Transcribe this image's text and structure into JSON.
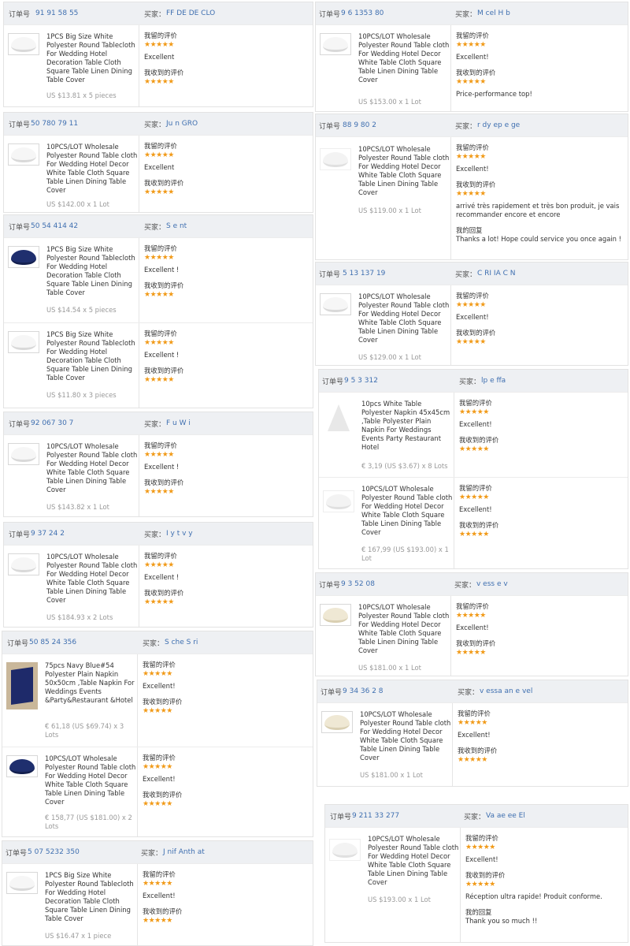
{
  "labels": {
    "order_no": "订单号",
    "buyer": "买家：",
    "my_review": "我留的评价",
    "received_review": "我收到的评价",
    "my_reply": "我的回复",
    "stars": "★★★★★"
  },
  "left_column": [
    {
      "order_no": "91 91 58 55",
      "buyer": "FF DE DE CLO",
      "items": [
        {
          "thumb": "white",
          "title": "1PCS Big Size White Polyester Round Tablecloth For Wedding Hotel Decoration Table Cloth Square Table Linen Dining Table Cover",
          "price": "US $13.81 x 5 pieces",
          "my_review": "Excellent",
          "received_review": ""
        }
      ]
    },
    {
      "order_no": "50 780 79 11",
      "buyer": "Ju n GRO",
      "items": [
        {
          "thumb": "white",
          "title": "10PCS/LOT Wholesale Polyester Round Table cloth For Wedding Hotel Decor White Table Cloth Square Table Linen Dining Table Cover",
          "price": "US $142.00 x 1 Lot",
          "my_review": "Excellent",
          "received_review": ""
        }
      ]
    },
    {
      "order_no": "50 54 414 42",
      "buyer": "S e nt",
      "items": [
        {
          "thumb": "navy",
          "title": "1PCS Big Size White Polyester Round Tablecloth For Wedding Hotel Decoration Table Cloth Square Table Linen Dining Table Cover",
          "price": "US $14.54 x 5 pieces",
          "my_review": "Excellent !",
          "received_review": ""
        },
        {
          "thumb": "white",
          "title": "1PCS Big Size White Polyester Round Tablecloth For Wedding Hotel Decoration Table Cloth Square Table Linen Dining Table Cover",
          "price": "US $11.80 x 3 pieces",
          "my_review": "Excellent !",
          "received_review": ""
        }
      ]
    },
    {
      "order_no": "92 067 30 7",
      "buyer": "F u W i",
      "items": [
        {
          "thumb": "white",
          "title": "10PCS/LOT Wholesale Polyester Round Table cloth For Wedding Hotel Decor White Table Cloth Square Table Linen Dining Table Cover",
          "price": "US $143.82 x 1 Lot",
          "my_review": "Excellent !",
          "received_review": ""
        }
      ]
    },
    {
      "order_no": "9 37 24 2",
      "buyer": "I y t v y",
      "items": [
        {
          "thumb": "white",
          "title": "10PCS/LOT Wholesale Polyester Round Table cloth For Wedding Hotel Decor White Table Cloth Square Table Linen Dining Table Cover",
          "price": "US $184.93 x 2 Lots",
          "my_review": "Excellent !",
          "received_review": ""
        }
      ]
    },
    {
      "order_no": "50 85 24 356",
      "buyer": "S che S ri",
      "items": [
        {
          "thumb": "navynap",
          "title": "75pcs Navy Blue#54 Polyester Plain Napkin 50x50cm ,Table Napkin For Weddings Events &Party&Restaurant &Hotel",
          "price": "€ 61,18 (US $69.74) x 3 Lots",
          "my_review": "Excellent!",
          "received_review": ""
        },
        {
          "thumb": "navy",
          "title": "10PCS/LOT Wholesale Polyester Round Table cloth For Wedding Hotel Decor White Table Cloth Square Table Linen Dining Table Cover",
          "price": "€ 158,77 (US $181.00) x 2 Lots",
          "my_review": "Excellent!",
          "received_review": ""
        }
      ]
    },
    {
      "order_no": "5 07 5232 350",
      "buyer": "J nif Anth at",
      "items": [
        {
          "thumb": "white",
          "title": "1PCS Big Size White Polyester Round Tablecloth For Wedding Hotel Decoration Table Cloth Square Table Linen Dining Table Cover",
          "price": "US $16.47 x 1 piece",
          "my_review": "Excellent!",
          "received_review": ""
        }
      ]
    }
  ],
  "right_column": [
    {
      "order_no": "9 6 1353 80",
      "buyer": "M cel H b",
      "items": [
        {
          "thumb": "white",
          "title": "10PCS/LOT Wholesale Polyester Round Table cloth For Wedding Hotel Decor White Table Cloth Square Table Linen Dining Table Cover",
          "price": "US $153.00 x 1 Lot",
          "my_review": "Excellent!",
          "received_review": "Price-performance top!",
          "reply": ""
        }
      ]
    },
    {
      "order_no": "88 9 80 2",
      "buyer": "r dy ep e ge",
      "items": [
        {
          "thumb": "light",
          "title": "10PCS/LOT Wholesale Polyester Round Table cloth For Wedding Hotel Decor White Table Cloth Square Table Linen Dining Table Cover",
          "price": "US $119.00 x 1 Lot",
          "my_review": "Excellent!",
          "received_review": "arrivé très rapidement et très bon produit, je vais recommander encore et encore",
          "reply": "Thanks a lot! Hope could service you once again !"
        }
      ]
    },
    {
      "order_no": "5 13 137 19",
      "buyer": "C RI IA C N",
      "items": [
        {
          "thumb": "white",
          "title": "10PCS/LOT Wholesale Polyester Round Table cloth For Wedding Hotel Decor White Table Cloth Square Table Linen Dining Table Cover",
          "price": "US $129.00 x 1 Lot",
          "my_review": "Excellent!",
          "received_review": "",
          "reply": ""
        }
      ]
    },
    {
      "order_no": "9 5 3 312",
      "buyer": "lp e ffa",
      "items": [
        {
          "thumb": "napkin",
          "title": "10pcs White Table Polyester Napkin 45x45cm ,Table Polyester Plain Napkin For Weddings Events Party Restaurant Hotel",
          "price": "€ 3,19 (US $3.67) x 8 Lots",
          "my_review": "Excellent!",
          "received_review": "",
          "reply": ""
        },
        {
          "thumb": "light",
          "title": "10PCS/LOT Wholesale Polyester Round Table cloth For Wedding Hotel Decor White Table Cloth Square Table Linen Dining Table Cover",
          "price": "€ 167,99 (US $193.00) x 1 Lot",
          "my_review": "Excellent!",
          "received_review": "",
          "reply": ""
        }
      ]
    },
    {
      "order_no": "9 3 52 08",
      "buyer": "v ess e v",
      "items": [
        {
          "thumb": "cream",
          "title": "10PCS/LOT Wholesale Polyester Round Table cloth For Wedding Hotel Decor White Table Cloth Square Table Linen Dining Table Cover",
          "price": "US $181.00 x 1 Lot",
          "my_review": "Excellent!",
          "received_review": "",
          "reply": ""
        }
      ]
    },
    {
      "order_no": "9 34 36 2 8",
      "buyer": "v essa an e vel",
      "items": [
        {
          "thumb": "cream",
          "title": "10PCS/LOT Wholesale Polyester Round Table cloth For Wedding Hotel Decor White Table Cloth Square Table Linen Dining Table Cover",
          "price": "US $181.00 x 1 Lot",
          "my_review": "Excellent!",
          "received_review": "",
          "reply": ""
        }
      ]
    },
    {
      "order_no": "9 211 33 277",
      "buyer": "Va ae ee El",
      "items": [
        {
          "thumb": "light",
          "title": "10PCS/LOT Wholesale Polyester Round Table cloth For Wedding Hotel Decor White Table Cloth Square Table Linen Dining Table Cover",
          "price": "US $193.00 x 1 Lot",
          "my_review": "Excellent!",
          "received_review": "Réception ultra rapide! Produit conforme.",
          "reply": "Thank you so much !!"
        }
      ]
    }
  ]
}
